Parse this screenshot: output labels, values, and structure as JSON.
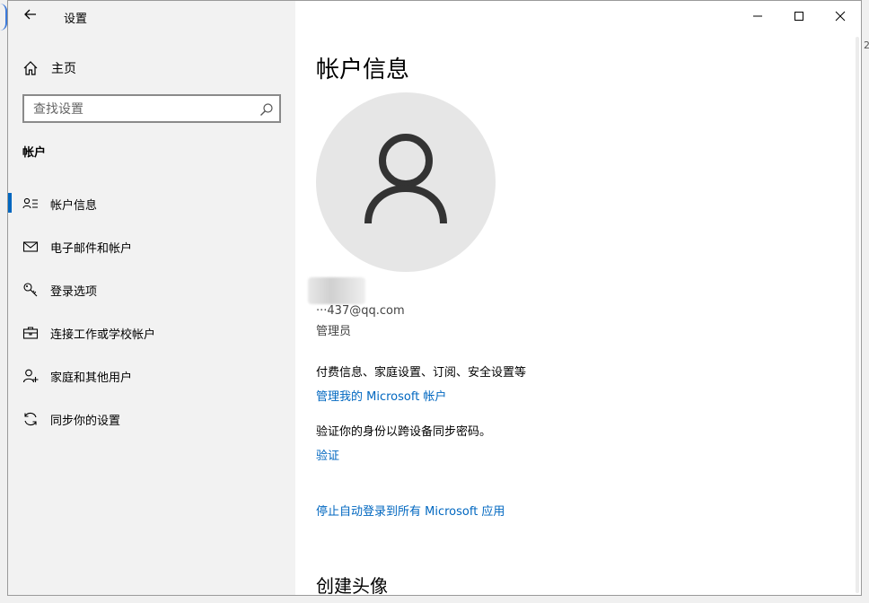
{
  "titlebar": {
    "app_title": "设置",
    "icons": [
      "back-arrow-icon",
      "minimize-icon",
      "maximize-icon",
      "close-icon"
    ]
  },
  "sidebar": {
    "home_label": "主页",
    "search_placeholder": "查找设置",
    "section_title": "帐户",
    "items": [
      {
        "label": "帐户信息",
        "icon": "person-list-icon",
        "selected": true
      },
      {
        "label": "电子邮件和帐户",
        "icon": "mail-icon",
        "selected": false
      },
      {
        "label": "登录选项",
        "icon": "key-icon",
        "selected": false
      },
      {
        "label": "连接工作或学校帐户",
        "icon": "briefcase-icon",
        "selected": false
      },
      {
        "label": "家庭和其他用户",
        "icon": "person-add-icon",
        "selected": false
      },
      {
        "label": "同步你的设置",
        "icon": "sync-icon",
        "selected": false
      }
    ]
  },
  "main": {
    "page_title": "帐户信息",
    "user": {
      "name": "",
      "email": "···437@qq.com",
      "role": "管理员"
    },
    "billing_text": "付费信息、家庭设置、订阅、安全设置等",
    "manage_link": "管理我的 Microsoft 帐户",
    "verify_text": "验证你的身份以跨设备同步密码。",
    "verify_link": "验证",
    "stop_signin_link": "停止自动登录到所有 Microsoft 应用",
    "create_avatar_heading": "创建头像"
  },
  "edge_fragment": "2",
  "colors": {
    "accent": "#0067c0",
    "sidebar_bg": "#f2f2f2",
    "avatar_bg": "#e6e6e6"
  }
}
